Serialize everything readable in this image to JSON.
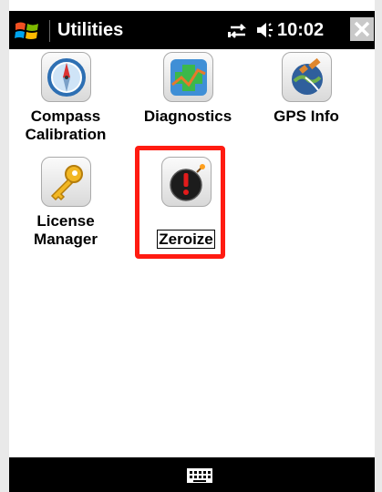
{
  "titlebar": {
    "title": "Utilities",
    "clock": "10:02"
  },
  "apps": [
    {
      "name": "compass-calibration",
      "label": "Compass\nCalibration",
      "icon": "compass-icon"
    },
    {
      "name": "diagnostics",
      "label": "Diagnostics",
      "icon": "diagnostics-icon"
    },
    {
      "name": "gps-info",
      "label": "GPS Info",
      "icon": "satellite-icon"
    },
    {
      "name": "license-manager",
      "label": "License\nManager",
      "icon": "key-icon"
    },
    {
      "name": "zeroize",
      "label": "Zeroize",
      "icon": "bomb-icon",
      "selected": true
    }
  ],
  "colors": {
    "highlight": "#ff1b11",
    "bar": "#000000"
  }
}
